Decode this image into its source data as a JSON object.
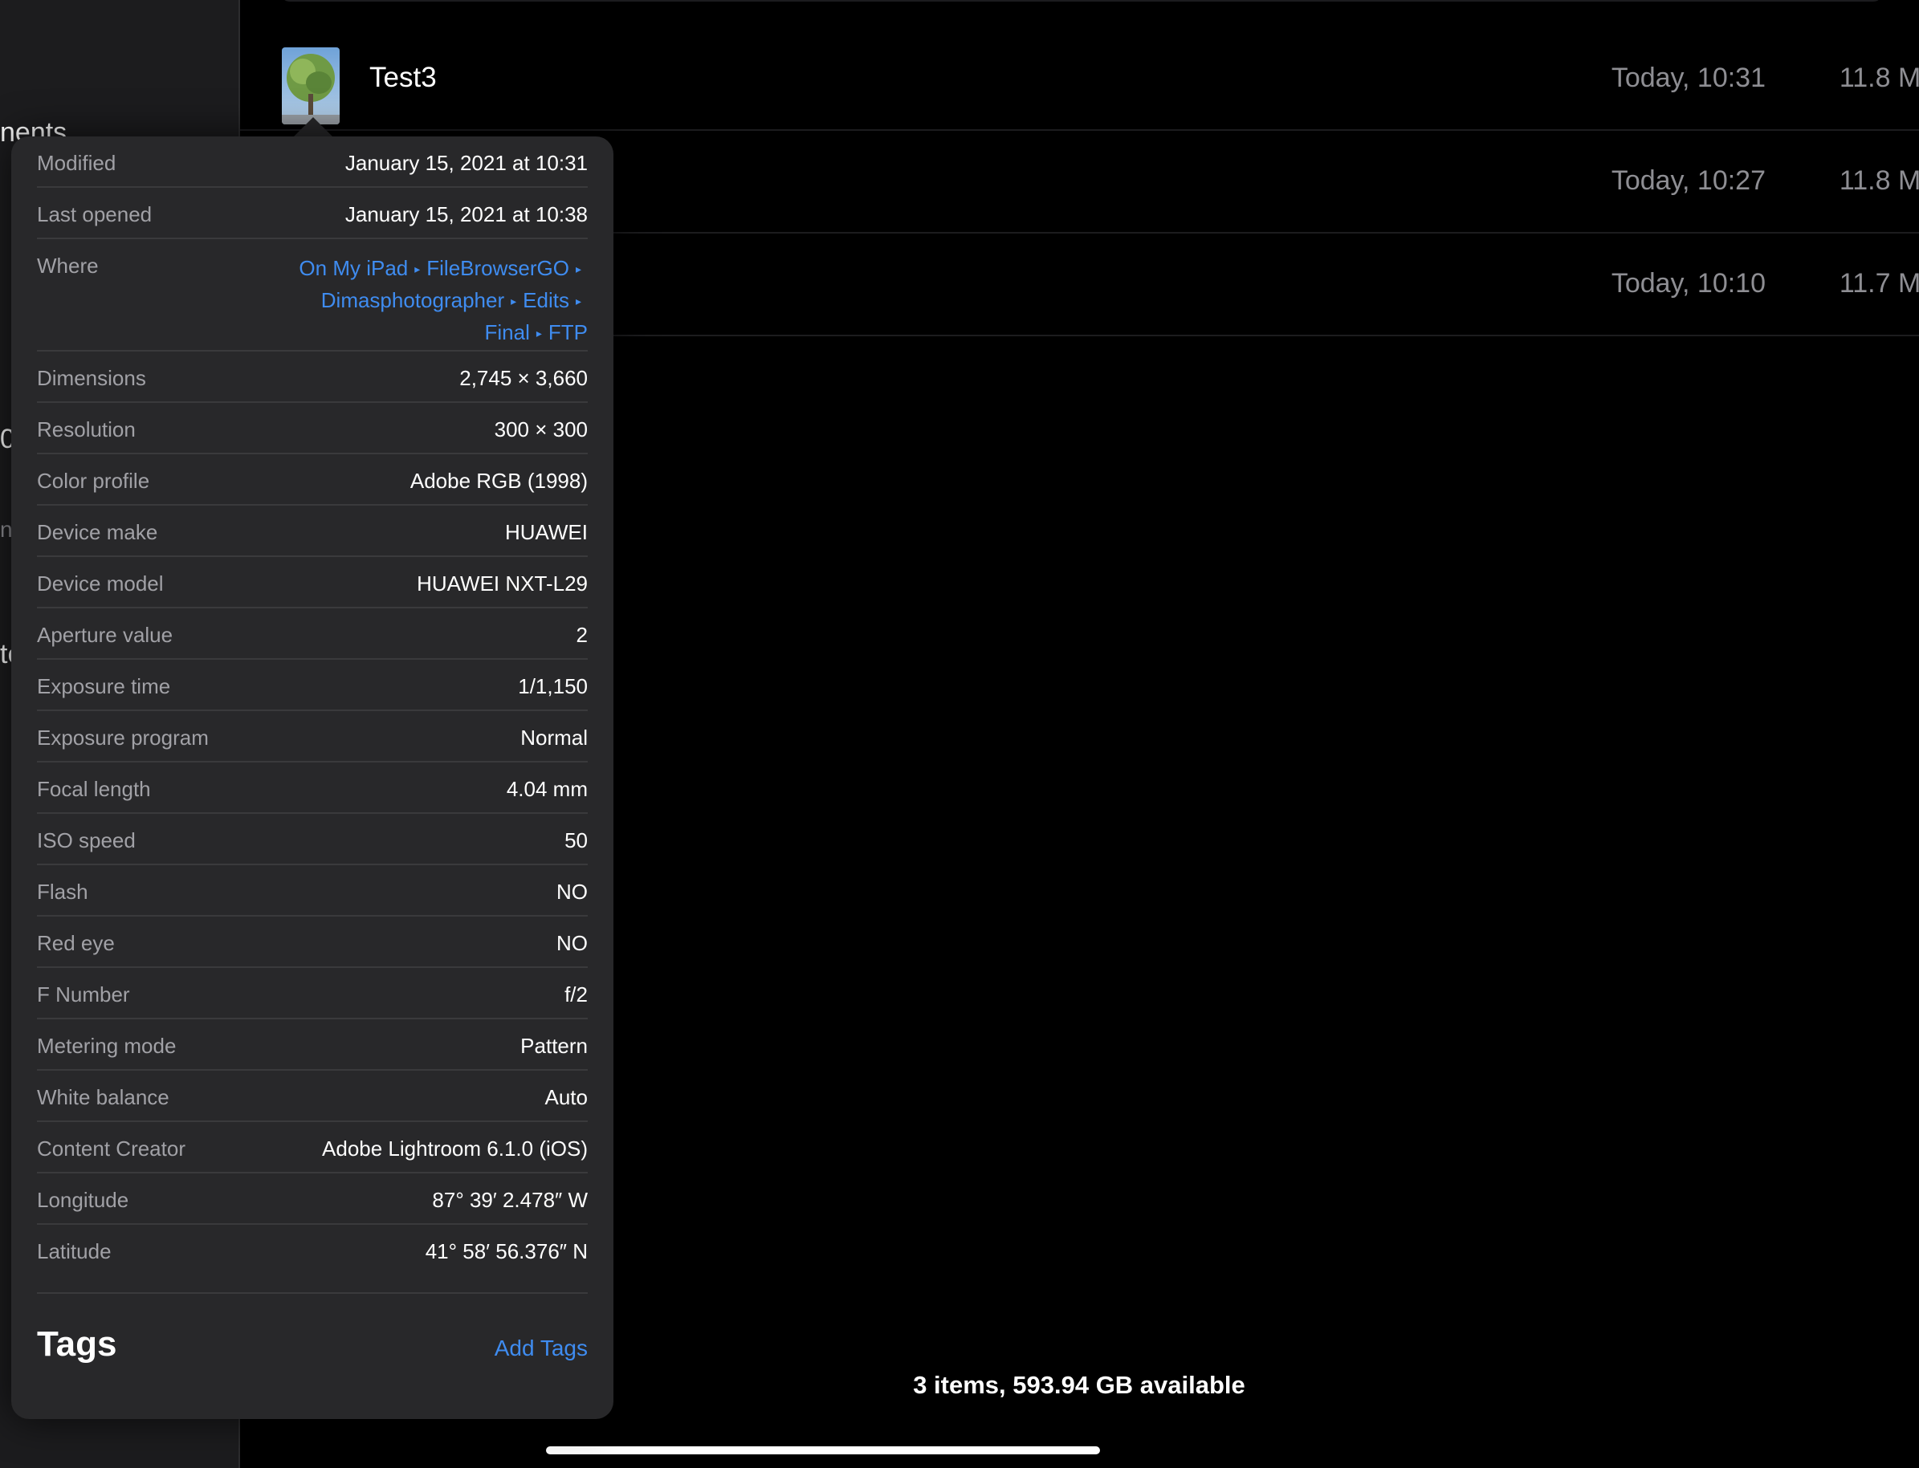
{
  "sidebar": {
    "fragments": [
      "nents",
      "0",
      "ne",
      "te"
    ]
  },
  "files": [
    {
      "name": "Test3",
      "date": "Today, 10:31",
      "size": "11.8 MB"
    },
    {
      "name": "",
      "date": "Today, 10:27",
      "size": "11.8 MB"
    },
    {
      "name": "",
      "date": "Today, 10:10",
      "size": "11.7 MB"
    }
  ],
  "footer": {
    "status": "3 items, 593.94 GB available"
  },
  "info": {
    "modified": {
      "label": "Modified",
      "value": "January 15, 2021 at 10:31"
    },
    "last_opened": {
      "label": "Last opened",
      "value": "January 15, 2021 at 10:38"
    },
    "where": {
      "label": "Where",
      "path": [
        "On My iPad",
        "FileBrowserGO",
        "Dimasphotographer",
        "Edits",
        "Final",
        "FTP"
      ]
    },
    "rows": [
      {
        "label": "Dimensions",
        "value": "2,745 × 3,660"
      },
      {
        "label": "Resolution",
        "value": "300 × 300"
      },
      {
        "label": "Color profile",
        "value": "Adobe RGB (1998)"
      },
      {
        "label": "Device make",
        "value": "HUAWEI"
      },
      {
        "label": "Device model",
        "value": "HUAWEI NXT-L29"
      },
      {
        "label": "Aperture value",
        "value": "2"
      },
      {
        "label": "Exposure time",
        "value": "1/1,150"
      },
      {
        "label": "Exposure program",
        "value": "Normal"
      },
      {
        "label": "Focal length",
        "value": "4.04 mm"
      },
      {
        "label": "ISO speed",
        "value": "50"
      },
      {
        "label": "Flash",
        "value": "NO"
      },
      {
        "label": "Red eye",
        "value": "NO"
      },
      {
        "label": "F Number",
        "value": "f/2"
      },
      {
        "label": "Metering mode",
        "value": "Pattern"
      },
      {
        "label": "White balance",
        "value": "Auto"
      },
      {
        "label": "Content Creator",
        "value": "Adobe Lightroom 6.1.0 (iOS)"
      },
      {
        "label": "Longitude",
        "value": "87° 39′ 2.478″ W"
      },
      {
        "label": "Latitude",
        "value": "41° 58′ 56.376″ N"
      }
    ]
  },
  "tags": {
    "title": "Tags",
    "add_label": "Add Tags"
  },
  "colors": {
    "accent": "#3f8cf0",
    "background": "#000000",
    "popover": "#28282a",
    "secondary_text": "#8e8e93"
  }
}
